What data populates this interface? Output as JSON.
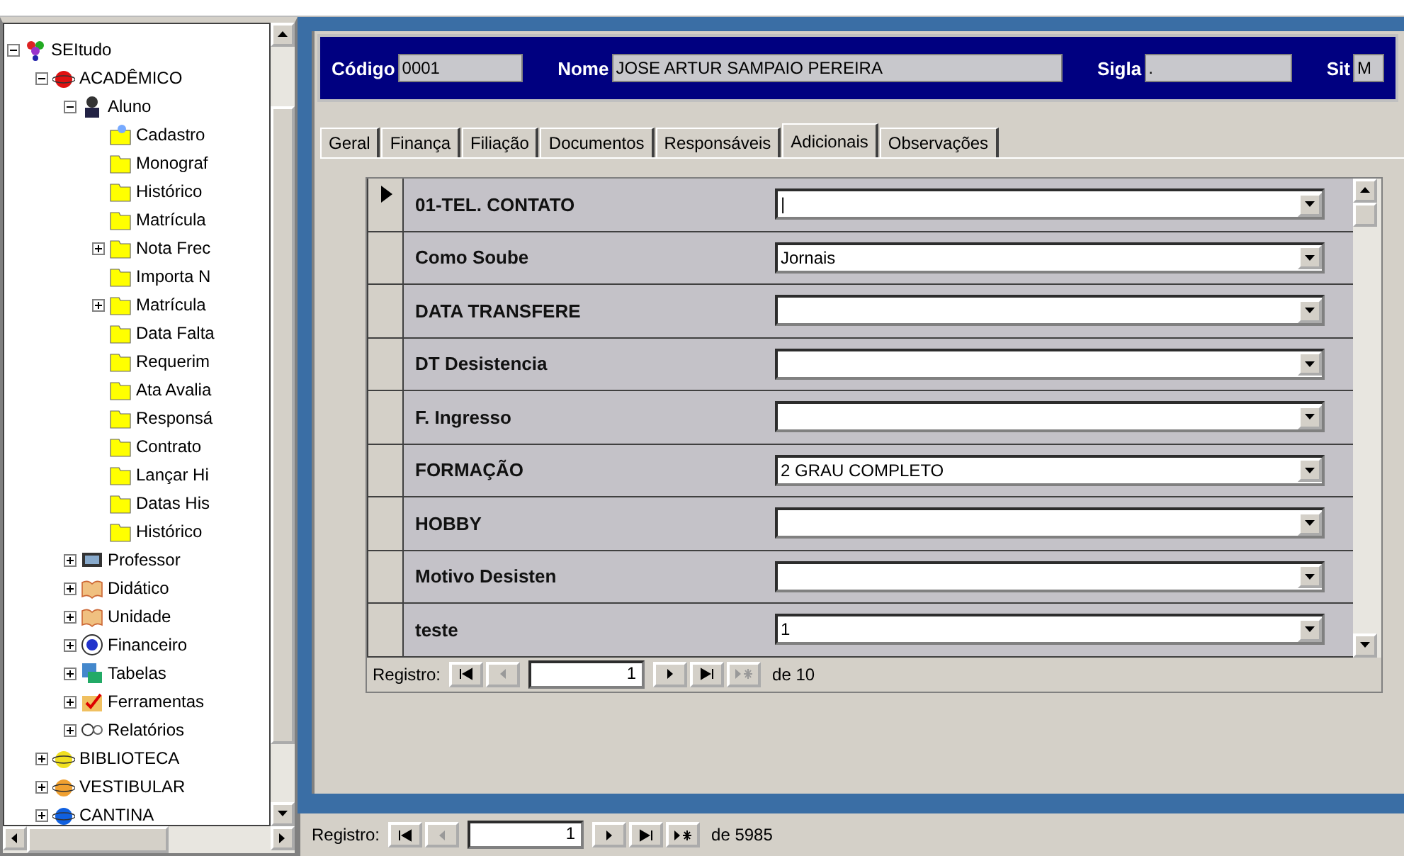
{
  "tree": [
    {
      "label": "SEItudo",
      "kind": "root",
      "expanded": true,
      "children": [
        {
          "label": "ACADÊMICO",
          "kind": "module",
          "color": "#e01010",
          "expanded": true,
          "children": [
            {
              "label": "Aluno",
              "kind": "person",
              "expanded": true,
              "children": [
                {
                  "label": "Cadastro",
                  "kind": "file"
                },
                {
                  "label": "Monograf",
                  "kind": "folder"
                },
                {
                  "label": "Histórico",
                  "kind": "folder"
                },
                {
                  "label": "Matrícula",
                  "kind": "folder"
                },
                {
                  "label": "Nota Frec",
                  "kind": "folder",
                  "expanded": false
                },
                {
                  "label": "Importa N",
                  "kind": "folder"
                },
                {
                  "label": "Matrícula",
                  "kind": "folder",
                  "expanded": false
                },
                {
                  "label": "Data Falta",
                  "kind": "folder"
                },
                {
                  "label": "Requerim",
                  "kind": "folder"
                },
                {
                  "label": "Ata Avalia",
                  "kind": "folder"
                },
                {
                  "label": "Responsá",
                  "kind": "folder"
                },
                {
                  "label": "Contrato",
                  "kind": "folder"
                },
                {
                  "label": "Lançar Hi",
                  "kind": "folder"
                },
                {
                  "label": "Datas His",
                  "kind": "folder"
                },
                {
                  "label": "Histórico",
                  "kind": "folder"
                }
              ]
            },
            {
              "label": "Professor",
              "kind": "screen",
              "expanded": false
            },
            {
              "label": "Didático",
              "kind": "book",
              "expanded": false
            },
            {
              "label": "Unidade",
              "kind": "book",
              "expanded": false
            },
            {
              "label": "Financeiro",
              "kind": "coin",
              "expanded": false
            },
            {
              "label": "Tabelas",
              "kind": "table",
              "expanded": false
            },
            {
              "label": "Ferramentas",
              "kind": "check",
              "expanded": false
            },
            {
              "label": "Relatórios",
              "kind": "glasses",
              "expanded": false
            }
          ]
        },
        {
          "label": "BIBLIOTECA",
          "kind": "module",
          "color": "#f0e020",
          "expanded": false
        },
        {
          "label": "VESTIBULAR",
          "kind": "module",
          "color": "#f0a030",
          "expanded": false
        },
        {
          "label": "CANTINA",
          "kind": "module",
          "color": "#1060e0",
          "expanded": false
        }
      ]
    }
  ],
  "header": [
    {
      "label": "Código",
      "value": "0001"
    },
    {
      "label": "Nome",
      "value": "JOSE ARTUR SAMPAIO PEREIRA"
    },
    {
      "label": "Sigla",
      "value": "."
    },
    {
      "label": "Sit",
      "value": "M"
    }
  ],
  "tabs": [
    {
      "label": "Geral",
      "selected": false
    },
    {
      "label": "Finança",
      "selected": false
    },
    {
      "label": "Filiação",
      "selected": false
    },
    {
      "label": "Documentos",
      "selected": false
    },
    {
      "label": "Responsáveis",
      "selected": false
    },
    {
      "label": "Adicionais",
      "selected": true
    },
    {
      "label": "Observações",
      "selected": false
    }
  ],
  "rows": [
    {
      "label": "01-TEL. CONTATO",
      "value": "|",
      "current": true
    },
    {
      "label": "Como Soube",
      "value": "Jornais",
      "current": false
    },
    {
      "label": "DATA  TRANSFERE",
      "value": "",
      "current": false
    },
    {
      "label": "DT Desistencia",
      "value": "",
      "current": false
    },
    {
      "label": "F. Ingresso",
      "value": "",
      "current": false
    },
    {
      "label": "FORMAÇÃO",
      "value": "2 GRAU COMPLETO",
      "current": false
    },
    {
      "label": "HOBBY",
      "value": "",
      "current": false
    },
    {
      "label": "Motivo Desisten",
      "value": "",
      "current": false
    },
    {
      "label": "teste",
      "value": "1",
      "current": false
    }
  ],
  "subform_nav": {
    "label": "Registro:",
    "record": "1",
    "of": "de  10"
  },
  "main_nav": {
    "label": "Registro:",
    "record": "1",
    "of": "de  5985"
  }
}
